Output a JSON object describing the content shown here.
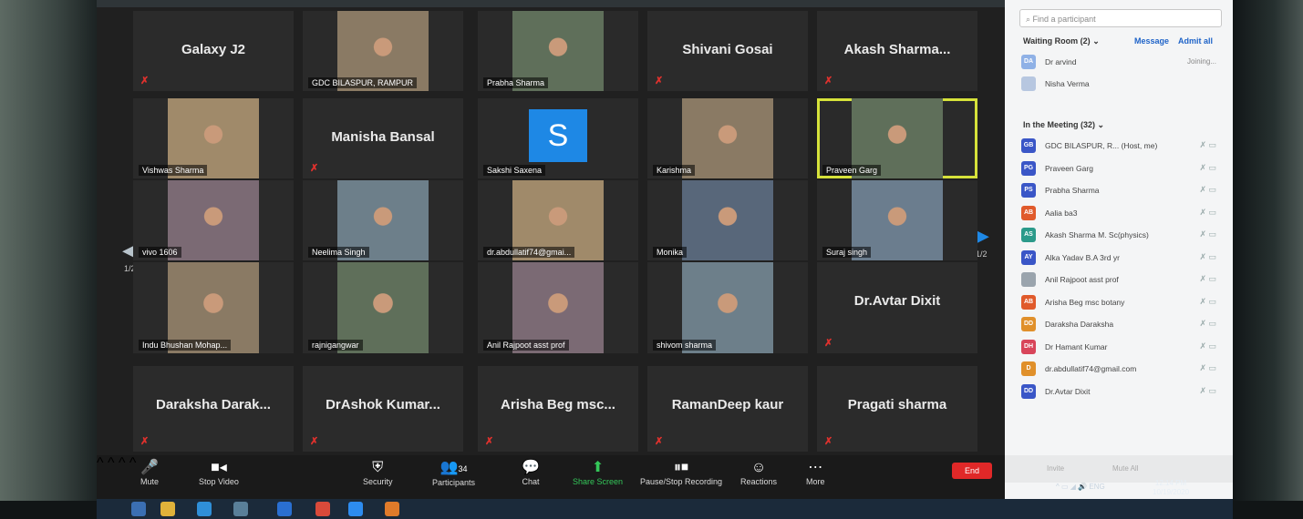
{
  "gallery": {
    "tiles": [
      {
        "name": "Galaxy J2",
        "label": "",
        "type": "name"
      },
      {
        "name": "",
        "label": "GDC BILASPUR, RAMPUR",
        "type": "video"
      },
      {
        "name": "",
        "label": "Prabha Sharma",
        "type": "video"
      },
      {
        "name": "Shivani Gosai",
        "label": "",
        "type": "name"
      },
      {
        "name": "Akash Sharma...",
        "label": "",
        "type": "name"
      },
      {
        "name": "",
        "label": "Vishwas Sharma",
        "type": "video"
      },
      {
        "name": "Manisha Bansal",
        "label": "",
        "type": "name"
      },
      {
        "name": "",
        "label": "Sakshi Saxena",
        "type": "avatar",
        "avatar": "S"
      },
      {
        "name": "",
        "label": "Karishma",
        "type": "video"
      },
      {
        "name": "",
        "label": "Praveen Garg",
        "type": "video"
      },
      {
        "name": "",
        "label": "vivo 1606",
        "type": "video"
      },
      {
        "name": "",
        "label": "Neelima Singh",
        "type": "video"
      },
      {
        "name": "",
        "label": "dr.abdullatif74@gmai...",
        "type": "video"
      },
      {
        "name": "",
        "label": "Monika",
        "type": "video"
      },
      {
        "name": "",
        "label": "Suraj singh",
        "type": "video"
      },
      {
        "name": "",
        "label": "Indu Bhushan Mohap...",
        "type": "video"
      },
      {
        "name": "",
        "label": "rajnigangwar",
        "type": "video"
      },
      {
        "name": "",
        "label": "Anil Rajpoot asst prof",
        "type": "video"
      },
      {
        "name": "",
        "label": "shivom sharma",
        "type": "video"
      },
      {
        "name": "Dr.Avtar Dixit",
        "label": "",
        "type": "name"
      },
      {
        "name": "Daraksha Darak...",
        "label": "",
        "type": "name"
      },
      {
        "name": "DrAshok Kumar...",
        "label": "",
        "type": "name"
      },
      {
        "name": "Arisha Beg msc...",
        "label": "",
        "type": "name"
      },
      {
        "name": "RamanDeep kaur",
        "label": "",
        "type": "name"
      },
      {
        "name": "Pragati sharma",
        "label": "",
        "type": "name"
      }
    ],
    "page_left": "1/2",
    "page_right": "1/2"
  },
  "toolbar": {
    "mute": "Mute",
    "stop_video": "Stop Video",
    "security": "Security",
    "participants": "Participants",
    "participants_count": "34",
    "chat": "Chat",
    "share_screen": "Share Screen",
    "record": "Pause/Stop Recording",
    "reactions": "Reactions",
    "more": "More",
    "end": "End"
  },
  "panel": {
    "search_placeholder": "Find a participant",
    "waiting_room": "Waiting Room (2)",
    "message": "Message",
    "admit_all": "Admit all",
    "waiting": [
      {
        "initials": "DA",
        "name": "Dr arvind",
        "status": "Joining...",
        "color": "#8fb1e6"
      },
      {
        "initials": "",
        "name": "Nisha Verma",
        "status": "",
        "color": "#b7c7e0"
      }
    ],
    "in_meeting": "In the Meeting (32)",
    "participants": [
      {
        "initials": "GB",
        "name": "GDC BILASPUR, R... (Host, me)",
        "color": "#3a56c7"
      },
      {
        "initials": "PG",
        "name": "Praveen Garg",
        "color": "#3a56c7"
      },
      {
        "initials": "PS",
        "name": "Prabha Sharma",
        "color": "#3a56c7"
      },
      {
        "initials": "AB",
        "name": "Aalia ba3",
        "color": "#e05a2b"
      },
      {
        "initials": "AS",
        "name": "Akash Sharma M. Sc(physics)",
        "color": "#2b9a8a"
      },
      {
        "initials": "AY",
        "name": "Alka Yadav B.A 3rd yr",
        "color": "#3a56c7"
      },
      {
        "initials": "",
        "name": "Anil Rajpoot asst prof",
        "color": "#9aa4ad"
      },
      {
        "initials": "AB",
        "name": "Arisha Beg msc botany",
        "color": "#e05a2b"
      },
      {
        "initials": "DD",
        "name": "Daraksha Daraksha",
        "color": "#e0902b"
      },
      {
        "initials": "DH",
        "name": "Dr Hamant Kumar",
        "color": "#d8455a"
      },
      {
        "initials": "D",
        "name": "dr.abdullatif74@gmail.com",
        "color": "#e0902b"
      },
      {
        "initials": "DD",
        "name": "Dr.Avtar Dixit",
        "color": "#3a56c7"
      }
    ],
    "invite": "Invite",
    "mute_all": "Mute All"
  },
  "taskbar": {
    "lang": "ENG",
    "time": "12:14 PM",
    "date": "10/19/2020"
  }
}
